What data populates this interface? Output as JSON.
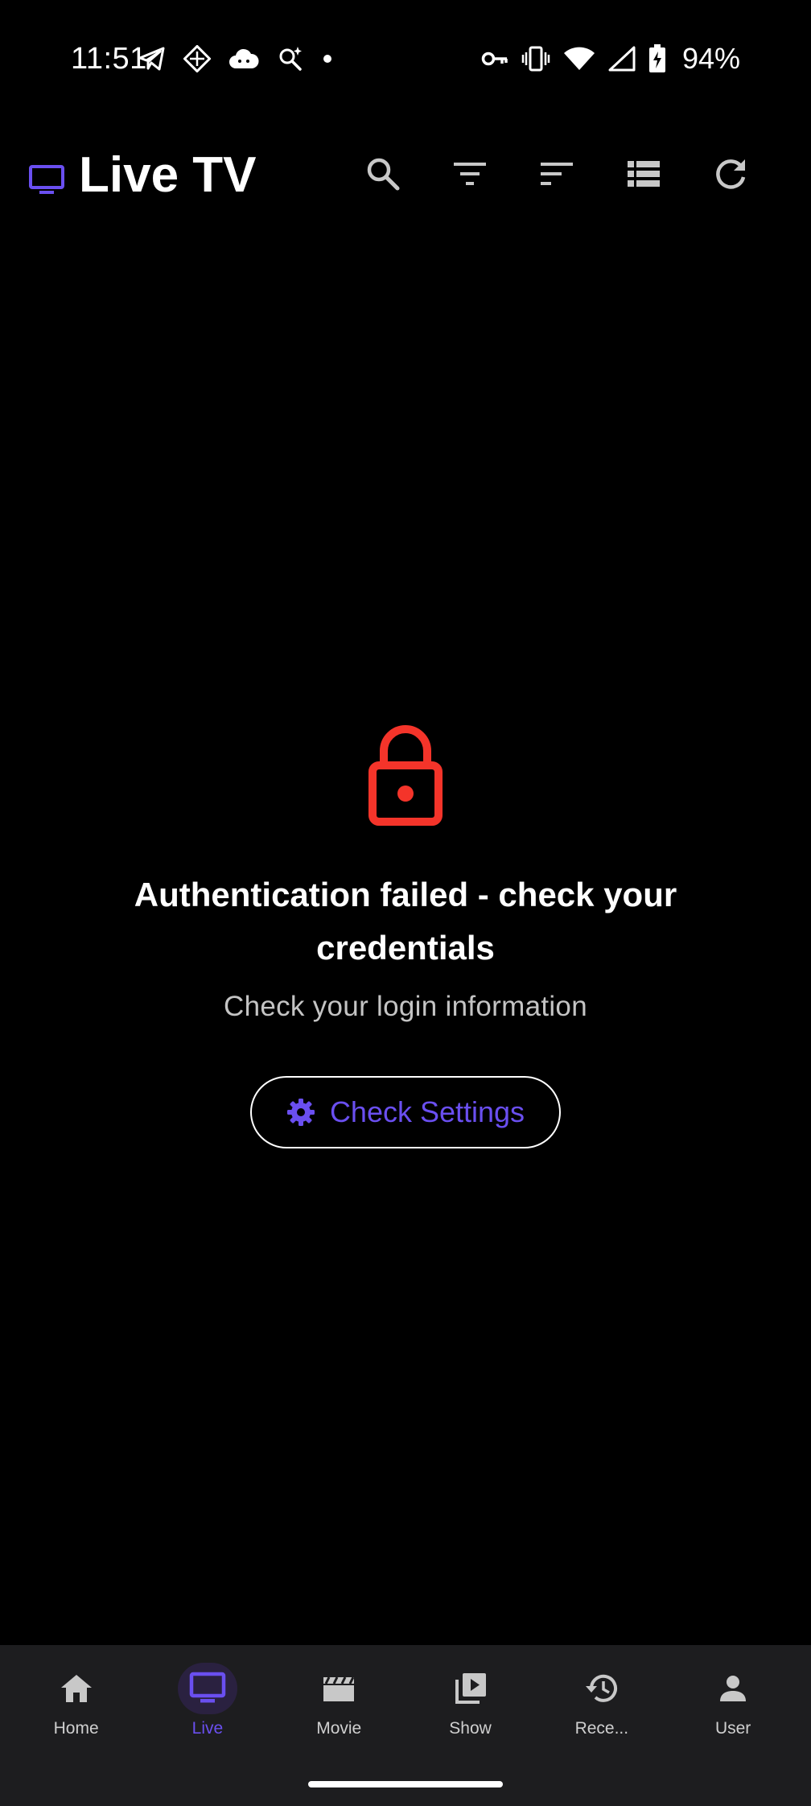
{
  "status_bar": {
    "time": "11:51",
    "battery_percent": "94%",
    "left_icons": [
      "telegram-icon",
      "diamond-grid-icon",
      "cloud-icon",
      "search-sparkle-icon",
      "dot-icon"
    ],
    "right_icons": [
      "key-icon",
      "vibrate-icon",
      "wifi-icon",
      "signal-icon",
      "battery-charging-icon"
    ]
  },
  "app_bar": {
    "title": "Live TV",
    "logo_icon": "tv-icon",
    "actions": [
      "search-icon",
      "filter-icon",
      "sort-icon",
      "list-view-icon",
      "refresh-icon"
    ]
  },
  "error": {
    "icon": "lock-icon",
    "title": "Authentication failed - check your credentials",
    "subtitle": "Check your login information",
    "button_label": "Check Settings",
    "button_icon": "gear-icon"
  },
  "bottom_nav": {
    "items": [
      {
        "label": "Home",
        "icon": "home-icon",
        "active": false
      },
      {
        "label": "Live",
        "icon": "tv-icon",
        "active": true
      },
      {
        "label": "Movie",
        "icon": "clapperboard-icon",
        "active": false
      },
      {
        "label": "Show",
        "icon": "video-library-icon",
        "active": false
      },
      {
        "label": "Rece...",
        "icon": "history-icon",
        "active": false
      },
      {
        "label": "User",
        "icon": "person-icon",
        "active": false
      }
    ]
  },
  "colors": {
    "accent": "#6a4ff0",
    "error": "#f4342a",
    "background": "#000000",
    "nav_background": "#1d1d1f"
  }
}
